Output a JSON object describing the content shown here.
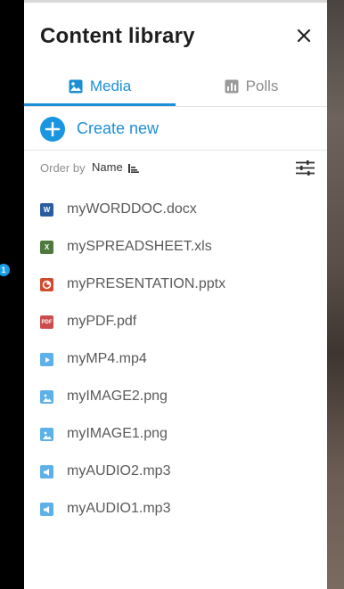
{
  "panel": {
    "title": "Content library",
    "close_icon": "close-icon"
  },
  "tabs": [
    {
      "label": "Media",
      "icon": "image-icon",
      "active": true
    },
    {
      "label": "Polls",
      "icon": "bar-chart-icon",
      "active": false
    }
  ],
  "create": {
    "label": "Create new",
    "icon": "plus-circle-icon"
  },
  "order": {
    "prefix": "Order by",
    "field": "Name"
  },
  "side_badge": "1",
  "colors": {
    "accent": "#1b8fd6",
    "word": "#2a5d9f",
    "excel": "#4f7a3e",
    "powerpoint": "#d14a2b",
    "pdf": "#cc4b4b",
    "media": "#5bb1e8"
  },
  "files": [
    {
      "name": "myWORDDOC.docx",
      "type": "word",
      "badge": "W"
    },
    {
      "name": "mySPREADSHEET.xls",
      "type": "excel",
      "badge": "X"
    },
    {
      "name": "myPRESENTATION.pptx",
      "type": "powerpoint",
      "badge": ""
    },
    {
      "name": "myPDF.pdf",
      "type": "pdf",
      "badge": "PDF"
    },
    {
      "name": "myMP4.mp4",
      "type": "video",
      "badge": ""
    },
    {
      "name": "myIMAGE2.png",
      "type": "image",
      "badge": ""
    },
    {
      "name": "myIMAGE1.png",
      "type": "image",
      "badge": ""
    },
    {
      "name": "myAUDIO2.mp3",
      "type": "audio",
      "badge": ""
    },
    {
      "name": "myAUDIO1.mp3",
      "type": "audio",
      "badge": ""
    }
  ]
}
